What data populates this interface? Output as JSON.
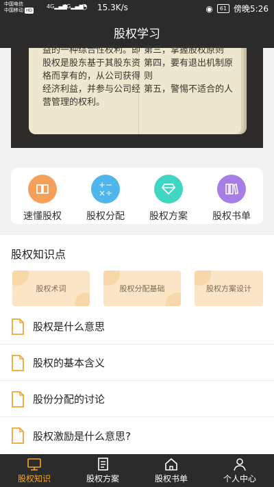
{
  "status_bar": {
    "carrier_1": "中国电信",
    "carrier_2": "中国移动",
    "hd": "HD",
    "net_1": "4G",
    "net_2": "4G",
    "speed": "15.3K/s",
    "battery": "61",
    "time": "傍晚5:26"
  },
  "header": {
    "title": "股权学习"
  },
  "banner": {
    "left_text": "益的一种综合性权利。即股权是股东基于其股东资格而享有的，从公司获得经济利益，并参与公司经营管理的权利。",
    "right_text": "第三，掌握股权原则\n第四，要有退出机制原则\n第五，警惕不适合的人"
  },
  "categories": [
    {
      "label": "速懂股权",
      "icon": "book-icon",
      "color": "#f5a05a"
    },
    {
      "label": "股权分配",
      "icon": "calculator-icon",
      "color": "#4fb6ec"
    },
    {
      "label": "股权方案",
      "icon": "diamond-icon",
      "color": "#41d6c3"
    },
    {
      "label": "股权书单",
      "icon": "books-icon",
      "color": "#a77de6"
    }
  ],
  "knowledge": {
    "title": "股权知识点",
    "chips": [
      "股权术词",
      "股权分配基础",
      "股权方案设计"
    ],
    "items": [
      "股权是什么意思",
      "股权的基本含义",
      "股份分配的讨论",
      "股权激励是什么意思?"
    ]
  },
  "bottom_nav": [
    {
      "label": "股权知识",
      "icon": "monitor-icon",
      "active": true
    },
    {
      "label": "股权方案",
      "icon": "document-icon",
      "active": false
    },
    {
      "label": "股权书单",
      "icon": "home-icon",
      "active": false
    },
    {
      "label": "个人中心",
      "icon": "user-icon",
      "active": false
    }
  ],
  "colors": {
    "accent": "#f5a623",
    "dark": "#2b2b2b",
    "chip_bg": "#fbe5c6"
  }
}
